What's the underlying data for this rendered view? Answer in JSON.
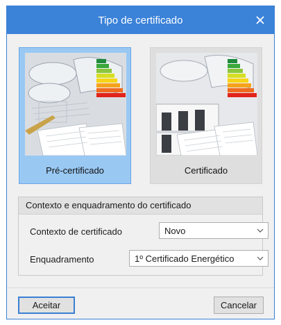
{
  "dialog": {
    "title": "Tipo de certificado",
    "close_icon": "close-icon"
  },
  "tiles": [
    {
      "label": "Pré-certificado",
      "selected": true
    },
    {
      "label": "Certificado",
      "selected": false
    }
  ],
  "group": {
    "title": "Contexto e enquadramento do certificado",
    "fields": [
      {
        "label": "Contexto de certificado",
        "value": "Novo"
      },
      {
        "label": "Enquadramento",
        "value": "1º Certificado Energético"
      }
    ]
  },
  "buttons": {
    "ok": "Aceitar",
    "cancel": "Cancelar"
  },
  "colors": {
    "titlebar": "#3b82d9",
    "selected_tile": "#99c8f3",
    "energy_bands": [
      "#1f8a3b",
      "#3aa83a",
      "#8cc63e",
      "#d6de23",
      "#f7d417",
      "#f6a21d",
      "#ef6b1f",
      "#e2231a"
    ]
  }
}
